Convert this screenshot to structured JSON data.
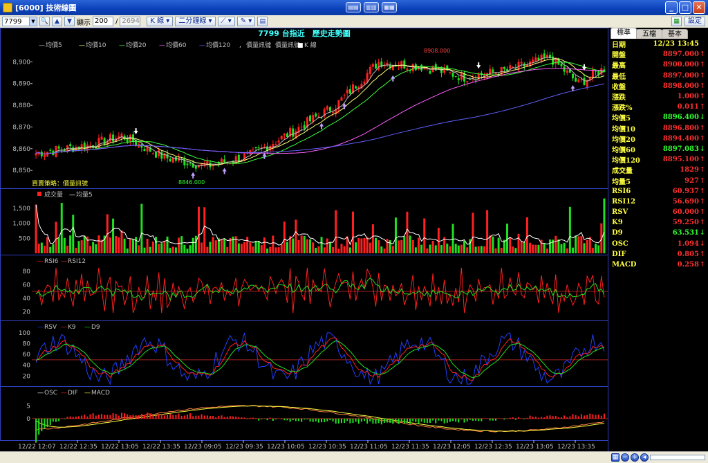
{
  "window": {
    "title": "[6000] 技術線圖"
  },
  "toolbar": {
    "symbol": "7799",
    "display_label": "顯示",
    "count": "200",
    "total": "2694",
    "kline": "K 線",
    "period": "二分鐘線",
    "settings": "設定"
  },
  "chart": {
    "title": "7799 台指近　歷史走勢圖",
    "legend_main": [
      "均價5",
      "均價10",
      "均價20",
      "均價60",
      "均價120",
      "價量訊號",
      "價量訊號",
      "K 線"
    ],
    "strategy_label": "買賣策略：價量訊號",
    "high_annot": "8908.000",
    "low_annot": "8846.000",
    "vol_legend": [
      "成交量",
      "均量5"
    ],
    "rsi_legend": [
      "RSI6",
      "RSI12"
    ],
    "kd_legend": [
      "RSV",
      "K9",
      "D9"
    ],
    "macd_legend": [
      "OSC",
      "DIF",
      "MACD"
    ],
    "time_labels": [
      "12/22 12:07",
      "12/22 12:35",
      "12/22 13:05",
      "12/22 13:35",
      "12/23 09:05",
      "12/23 09:35",
      "12/23 10:05",
      "12/23 10:35",
      "12/23 11:05",
      "12/23 11:35",
      "12/23 12:05",
      "12/23 12:35",
      "12/23 13:05",
      "12/23 13:35"
    ],
    "price_ticks": [
      "8,900",
      "8,890",
      "8,880",
      "8,870",
      "8,860",
      "8,850"
    ],
    "vol_ticks": [
      "1,500",
      "1,000",
      "500"
    ],
    "rsi_ticks": [
      "80",
      "60",
      "40",
      "20"
    ],
    "kd_ticks": [
      "100",
      "80",
      "60",
      "40",
      "20"
    ],
    "macd_ticks": [
      "5",
      "0"
    ],
    "colors": {
      "up": "#ff2020",
      "down": "#20e020",
      "ma5": "#c0c0c0",
      "ma10": "#ffff80",
      "ma20": "#40ff40",
      "ma60": "#ff60ff",
      "ma120": "#6060ff",
      "panel_border": "#3040c0"
    }
  },
  "side": {
    "tabs": [
      "標準",
      "五檔",
      "基本"
    ],
    "rows": [
      {
        "label": "日期",
        "value": "12/23 13:45",
        "color": "yellow",
        "arrow": ""
      },
      {
        "label": "開盤",
        "value": "8897.000",
        "color": "red",
        "arrow": "↑"
      },
      {
        "label": "最高",
        "value": "8900.000",
        "color": "red",
        "arrow": "↑"
      },
      {
        "label": "最低",
        "value": "8897.000",
        "color": "red",
        "arrow": "↑"
      },
      {
        "label": "收盤",
        "value": "8898.000",
        "color": "red",
        "arrow": "↑"
      },
      {
        "label": "漲跌",
        "value": "1.000",
        "color": "red",
        "arrow": "↑"
      },
      {
        "label": "漲跌%",
        "value": "0.011",
        "color": "red",
        "arrow": "↑"
      },
      {
        "label": "均價5",
        "value": "8896.400",
        "color": "green",
        "arrow": "↓"
      },
      {
        "label": "均價10",
        "value": "8896.800",
        "color": "red",
        "arrow": "↑"
      },
      {
        "label": "均價20",
        "value": "8894.400",
        "color": "red",
        "arrow": "↑"
      },
      {
        "label": "均價60",
        "value": "8897.083",
        "color": "green",
        "arrow": "↓"
      },
      {
        "label": "均價120",
        "value": "8895.100",
        "color": "red",
        "arrow": "↑"
      },
      {
        "label": "成交量",
        "value": "1829",
        "color": "red",
        "arrow": "↑"
      },
      {
        "label": "均量5",
        "value": "927",
        "color": "red",
        "arrow": "↑"
      },
      {
        "label": "RSI6",
        "value": "60.937",
        "color": "red",
        "arrow": "↑"
      },
      {
        "label": "RSI12",
        "value": "56.690",
        "color": "red",
        "arrow": "↑"
      },
      {
        "label": "RSV",
        "value": "60.000",
        "color": "red",
        "arrow": "↑"
      },
      {
        "label": "K9",
        "value": "59.250",
        "color": "red",
        "arrow": "↑"
      },
      {
        "label": "D9",
        "value": "63.531",
        "color": "green",
        "arrow": "↓"
      },
      {
        "label": "OSC",
        "value": "1.094",
        "color": "red",
        "arrow": "↓"
      },
      {
        "label": "DIF",
        "value": "0.805",
        "color": "red",
        "arrow": "↑"
      },
      {
        "label": "MACD",
        "value": "0.258",
        "color": "red",
        "arrow": "↑"
      }
    ]
  }
}
